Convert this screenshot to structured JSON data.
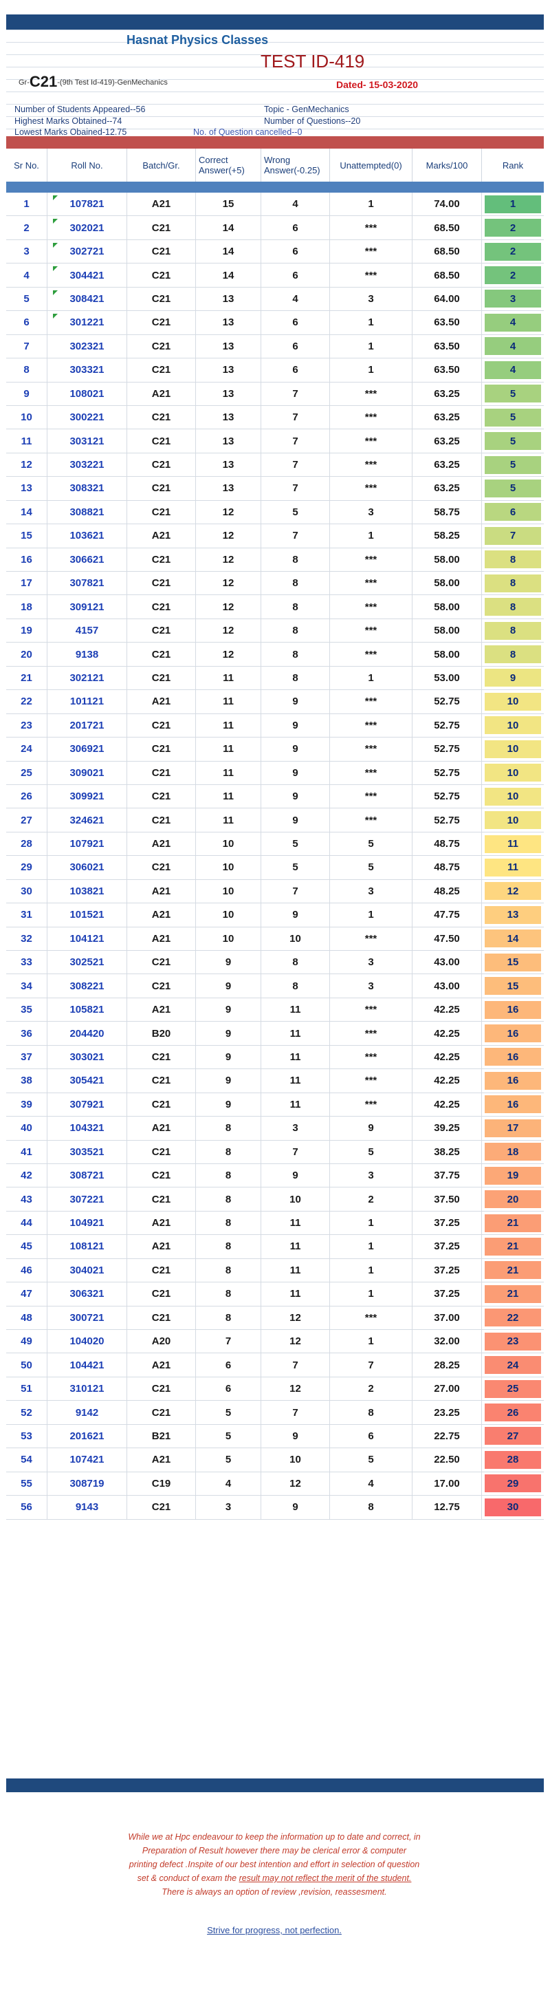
{
  "header": {
    "academy": "Hasnat Physics Classes",
    "test_id": "TEST ID-419",
    "group_prefix": "Gr-",
    "group_code": "C21",
    "group_suffix": "-(9th Test Id-419)-GenMechanics",
    "dated": "Dated- 15-03-2020",
    "students_appeared": "Number of Students Appeared--56",
    "topic": "Topic - GenMechanics",
    "highest_marks": "Highest Marks Obtained--74",
    "num_questions": "Number of Questions--20",
    "lowest_marks": "Lowest Marks Obained-12.75",
    "cancelled": "No. of Question cancelled--0"
  },
  "columns": {
    "sr": "Sr No.",
    "roll": "Roll No.",
    "batch": "Batch/Gr.",
    "correct": "Correct Answer(+5)",
    "wrong": "Wrong Answer(-0.25)",
    "unattempted": "Unattempted(0)",
    "marks": "Marks/100",
    "rank": "Rank"
  },
  "rank_colors": {
    "1": "#63be7b",
    "2": "#74c37c",
    "3": "#85c87d",
    "4": "#96cd7e",
    "5": "#a8d27f",
    "6": "#b9d780",
    "7": "#cadc81",
    "8": "#dbe081",
    "9": "#ece582",
    "10": "#f2e583",
    "11": "#fee582",
    "12": "#fed680",
    "13": "#fece7f",
    "14": "#fdc47d",
    "15": "#fdbd7b",
    "16": "#fdb77a",
    "17": "#fcb379",
    "18": "#fcab78",
    "19": "#fca877",
    "20": "#fca276",
    "21": "#fb9d75",
    "22": "#fb9774",
    "23": "#fb9273",
    "24": "#fa8c72",
    "25": "#fa8871",
    "26": "#fa8370",
    "27": "#f97e6f",
    "28": "#f9796e",
    "29": "#f8736d",
    "30": "#f8696b"
  },
  "rows": [
    {
      "sr": "1",
      "roll": "107821",
      "batch": "A21",
      "correct": "15",
      "wrong": "4",
      "un": "1",
      "marks": "74.00",
      "rank": "1",
      "flag": true
    },
    {
      "sr": "2",
      "roll": "302021",
      "batch": "C21",
      "correct": "14",
      "wrong": "6",
      "un": "***",
      "marks": "68.50",
      "rank": "2",
      "flag": true
    },
    {
      "sr": "3",
      "roll": "302721",
      "batch": "C21",
      "correct": "14",
      "wrong": "6",
      "un": "***",
      "marks": "68.50",
      "rank": "2",
      "flag": true
    },
    {
      "sr": "4",
      "roll": "304421",
      "batch": "C21",
      "correct": "14",
      "wrong": "6",
      "un": "***",
      "marks": "68.50",
      "rank": "2",
      "flag": true
    },
    {
      "sr": "5",
      "roll": "308421",
      "batch": "C21",
      "correct": "13",
      "wrong": "4",
      "un": "3",
      "marks": "64.00",
      "rank": "3",
      "flag": true
    },
    {
      "sr": "6",
      "roll": "301221",
      "batch": "C21",
      "correct": "13",
      "wrong": "6",
      "un": "1",
      "marks": "63.50",
      "rank": "4",
      "flag": true
    },
    {
      "sr": "7",
      "roll": "302321",
      "batch": "C21",
      "correct": "13",
      "wrong": "6",
      "un": "1",
      "marks": "63.50",
      "rank": "4"
    },
    {
      "sr": "8",
      "roll": "303321",
      "batch": "C21",
      "correct": "13",
      "wrong": "6",
      "un": "1",
      "marks": "63.50",
      "rank": "4"
    },
    {
      "sr": "9",
      "roll": "108021",
      "batch": "A21",
      "correct": "13",
      "wrong": "7",
      "un": "***",
      "marks": "63.25",
      "rank": "5"
    },
    {
      "sr": "10",
      "roll": "300221",
      "batch": "C21",
      "correct": "13",
      "wrong": "7",
      "un": "***",
      "marks": "63.25",
      "rank": "5"
    },
    {
      "sr": "11",
      "roll": "303121",
      "batch": "C21",
      "correct": "13",
      "wrong": "7",
      "un": "***",
      "marks": "63.25",
      "rank": "5"
    },
    {
      "sr": "12",
      "roll": "303221",
      "batch": "C21",
      "correct": "13",
      "wrong": "7",
      "un": "***",
      "marks": "63.25",
      "rank": "5"
    },
    {
      "sr": "13",
      "roll": "308321",
      "batch": "C21",
      "correct": "13",
      "wrong": "7",
      "un": "***",
      "marks": "63.25",
      "rank": "5"
    },
    {
      "sr": "14",
      "roll": "308821",
      "batch": "C21",
      "correct": "12",
      "wrong": "5",
      "un": "3",
      "marks": "58.75",
      "rank": "6"
    },
    {
      "sr": "15",
      "roll": "103621",
      "batch": "A21",
      "correct": "12",
      "wrong": "7",
      "un": "1",
      "marks": "58.25",
      "rank": "7"
    },
    {
      "sr": "16",
      "roll": "306621",
      "batch": "C21",
      "correct": "12",
      "wrong": "8",
      "un": "***",
      "marks": "58.00",
      "rank": "8"
    },
    {
      "sr": "17",
      "roll": "307821",
      "batch": "C21",
      "correct": "12",
      "wrong": "8",
      "un": "***",
      "marks": "58.00",
      "rank": "8"
    },
    {
      "sr": "18",
      "roll": "309121",
      "batch": "C21",
      "correct": "12",
      "wrong": "8",
      "un": "***",
      "marks": "58.00",
      "rank": "8"
    },
    {
      "sr": "19",
      "roll": "4157",
      "batch": "C21",
      "correct": "12",
      "wrong": "8",
      "un": "***",
      "marks": "58.00",
      "rank": "8"
    },
    {
      "sr": "20",
      "roll": "9138",
      "batch": "C21",
      "correct": "12",
      "wrong": "8",
      "un": "***",
      "marks": "58.00",
      "rank": "8"
    },
    {
      "sr": "21",
      "roll": "302121",
      "batch": "C21",
      "correct": "11",
      "wrong": "8",
      "un": "1",
      "marks": "53.00",
      "rank": "9"
    },
    {
      "sr": "22",
      "roll": "101121",
      "batch": "A21",
      "correct": "11",
      "wrong": "9",
      "un": "***",
      "marks": "52.75",
      "rank": "10"
    },
    {
      "sr": "23",
      "roll": "201721",
      "batch": "C21",
      "correct": "11",
      "wrong": "9",
      "un": "***",
      "marks": "52.75",
      "rank": "10"
    },
    {
      "sr": "24",
      "roll": "306921",
      "batch": "C21",
      "correct": "11",
      "wrong": "9",
      "un": "***",
      "marks": "52.75",
      "rank": "10"
    },
    {
      "sr": "25",
      "roll": "309021",
      "batch": "C21",
      "correct": "11",
      "wrong": "9",
      "un": "***",
      "marks": "52.75",
      "rank": "10"
    },
    {
      "sr": "26",
      "roll": "309921",
      "batch": "C21",
      "correct": "11",
      "wrong": "9",
      "un": "***",
      "marks": "52.75",
      "rank": "10"
    },
    {
      "sr": "27",
      "roll": "324621",
      "batch": "C21",
      "correct": "11",
      "wrong": "9",
      "un": "***",
      "marks": "52.75",
      "rank": "10"
    },
    {
      "sr": "28",
      "roll": "107921",
      "batch": "A21",
      "correct": "10",
      "wrong": "5",
      "un": "5",
      "marks": "48.75",
      "rank": "11"
    },
    {
      "sr": "29",
      "roll": "306021",
      "batch": "C21",
      "correct": "10",
      "wrong": "5",
      "un": "5",
      "marks": "48.75",
      "rank": "11"
    },
    {
      "sr": "30",
      "roll": "103821",
      "batch": "A21",
      "correct": "10",
      "wrong": "7",
      "un": "3",
      "marks": "48.25",
      "rank": "12"
    },
    {
      "sr": "31",
      "roll": "101521",
      "batch": "A21",
      "correct": "10",
      "wrong": "9",
      "un": "1",
      "marks": "47.75",
      "rank": "13"
    },
    {
      "sr": "32",
      "roll": "104121",
      "batch": "A21",
      "correct": "10",
      "wrong": "10",
      "un": "***",
      "marks": "47.50",
      "rank": "14"
    },
    {
      "sr": "33",
      "roll": "302521",
      "batch": "C21",
      "correct": "9",
      "wrong": "8",
      "un": "3",
      "marks": "43.00",
      "rank": "15"
    },
    {
      "sr": "34",
      "roll": "308221",
      "batch": "C21",
      "correct": "9",
      "wrong": "8",
      "un": "3",
      "marks": "43.00",
      "rank": "15"
    },
    {
      "sr": "35",
      "roll": "105821",
      "batch": "A21",
      "correct": "9",
      "wrong": "11",
      "un": "***",
      "marks": "42.25",
      "rank": "16"
    },
    {
      "sr": "36",
      "roll": "204420",
      "batch": "B20",
      "correct": "9",
      "wrong": "11",
      "un": "***",
      "marks": "42.25",
      "rank": "16"
    },
    {
      "sr": "37",
      "roll": "303021",
      "batch": "C21",
      "correct": "9",
      "wrong": "11",
      "un": "***",
      "marks": "42.25",
      "rank": "16"
    },
    {
      "sr": "38",
      "roll": "305421",
      "batch": "C21",
      "correct": "9",
      "wrong": "11",
      "un": "***",
      "marks": "42.25",
      "rank": "16"
    },
    {
      "sr": "39",
      "roll": "307921",
      "batch": "C21",
      "correct": "9",
      "wrong": "11",
      "un": "***",
      "marks": "42.25",
      "rank": "16"
    },
    {
      "sr": "40",
      "roll": "104321",
      "batch": "A21",
      "correct": "8",
      "wrong": "3",
      "un": "9",
      "marks": "39.25",
      "rank": "17"
    },
    {
      "sr": "41",
      "roll": "303521",
      "batch": "C21",
      "correct": "8",
      "wrong": "7",
      "un": "5",
      "marks": "38.25",
      "rank": "18"
    },
    {
      "sr": "42",
      "roll": "308721",
      "batch": "C21",
      "correct": "8",
      "wrong": "9",
      "un": "3",
      "marks": "37.75",
      "rank": "19"
    },
    {
      "sr": "43",
      "roll": "307221",
      "batch": "C21",
      "correct": "8",
      "wrong": "10",
      "un": "2",
      "marks": "37.50",
      "rank": "20"
    },
    {
      "sr": "44",
      "roll": "104921",
      "batch": "A21",
      "correct": "8",
      "wrong": "11",
      "un": "1",
      "marks": "37.25",
      "rank": "21"
    },
    {
      "sr": "45",
      "roll": "108121",
      "batch": "A21",
      "correct": "8",
      "wrong": "11",
      "un": "1",
      "marks": "37.25",
      "rank": "21"
    },
    {
      "sr": "46",
      "roll": "304021",
      "batch": "C21",
      "correct": "8",
      "wrong": "11",
      "un": "1",
      "marks": "37.25",
      "rank": "21"
    },
    {
      "sr": "47",
      "roll": "306321",
      "batch": "C21",
      "correct": "8",
      "wrong": "11",
      "un": "1",
      "marks": "37.25",
      "rank": "21"
    },
    {
      "sr": "48",
      "roll": "300721",
      "batch": "C21",
      "correct": "8",
      "wrong": "12",
      "un": "***",
      "marks": "37.00",
      "rank": "22"
    },
    {
      "sr": "49",
      "roll": "104020",
      "batch": "A20",
      "correct": "7",
      "wrong": "12",
      "un": "1",
      "marks": "32.00",
      "rank": "23"
    },
    {
      "sr": "50",
      "roll": "104421",
      "batch": "A21",
      "correct": "6",
      "wrong": "7",
      "un": "7",
      "marks": "28.25",
      "rank": "24"
    },
    {
      "sr": "51",
      "roll": "310121",
      "batch": "C21",
      "correct": "6",
      "wrong": "12",
      "un": "2",
      "marks": "27.00",
      "rank": "25"
    },
    {
      "sr": "52",
      "roll": "9142",
      "batch": "C21",
      "correct": "5",
      "wrong": "7",
      "un": "8",
      "marks": "23.25",
      "rank": "26"
    },
    {
      "sr": "53",
      "roll": "201621",
      "batch": "B21",
      "correct": "5",
      "wrong": "9",
      "un": "6",
      "marks": "22.75",
      "rank": "27"
    },
    {
      "sr": "54",
      "roll": "107421",
      "batch": "A21",
      "correct": "5",
      "wrong": "10",
      "un": "5",
      "marks": "22.50",
      "rank": "28"
    },
    {
      "sr": "55",
      "roll": "308719",
      "batch": "C19",
      "correct": "4",
      "wrong": "12",
      "un": "4",
      "marks": "17.00",
      "rank": "29"
    },
    {
      "sr": "56",
      "roll": "9143",
      "batch": "C21",
      "correct": "3",
      "wrong": "9",
      "un": "8",
      "marks": "12.75",
      "rank": "30"
    }
  ],
  "footer": {
    "line1": "While we at Hpc endeavour to keep the information up to date and correct,  in",
    "line2": "Preparation of Result   however there may   be clerical error & computer",
    "line3": "printing defect .Inspite of our best intention and effort in selection of question",
    "line4a": "set  & conduct of exam the ",
    "line4b": "result may not reflect the merit of the student.",
    "line5": "There is always an option  of review ,revision, reassesment.",
    "motto": "Strive for progress, not perfection."
  }
}
